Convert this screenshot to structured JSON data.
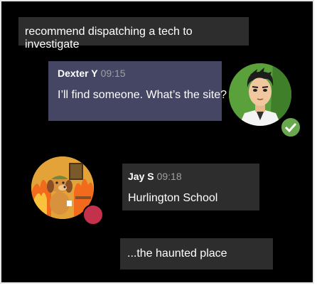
{
  "messages": [
    {
      "text": "recommend dispatching a tech to investigate"
    },
    {
      "author": "Dexter Y",
      "time": "09:15",
      "text": "I’ll find someone. What’s the site?"
    },
    {
      "author": "Jay S",
      "time": "09:18",
      "text": "Hurlington School"
    },
    {
      "text": "...the haunted place"
    }
  ],
  "avatars": {
    "dexter": {
      "icon": "cartoon-man-avatar-icon",
      "status": "available",
      "status_icon": "checkmark-icon"
    },
    "jay": {
      "icon": "dog-in-fire-avatar-icon",
      "status": "busy"
    }
  },
  "colors": {
    "background": "#000000",
    "bubble": "#2d2d2d",
    "bubble_self": "#454664",
    "available": "#6aa84f",
    "busy": "#c4314b"
  }
}
